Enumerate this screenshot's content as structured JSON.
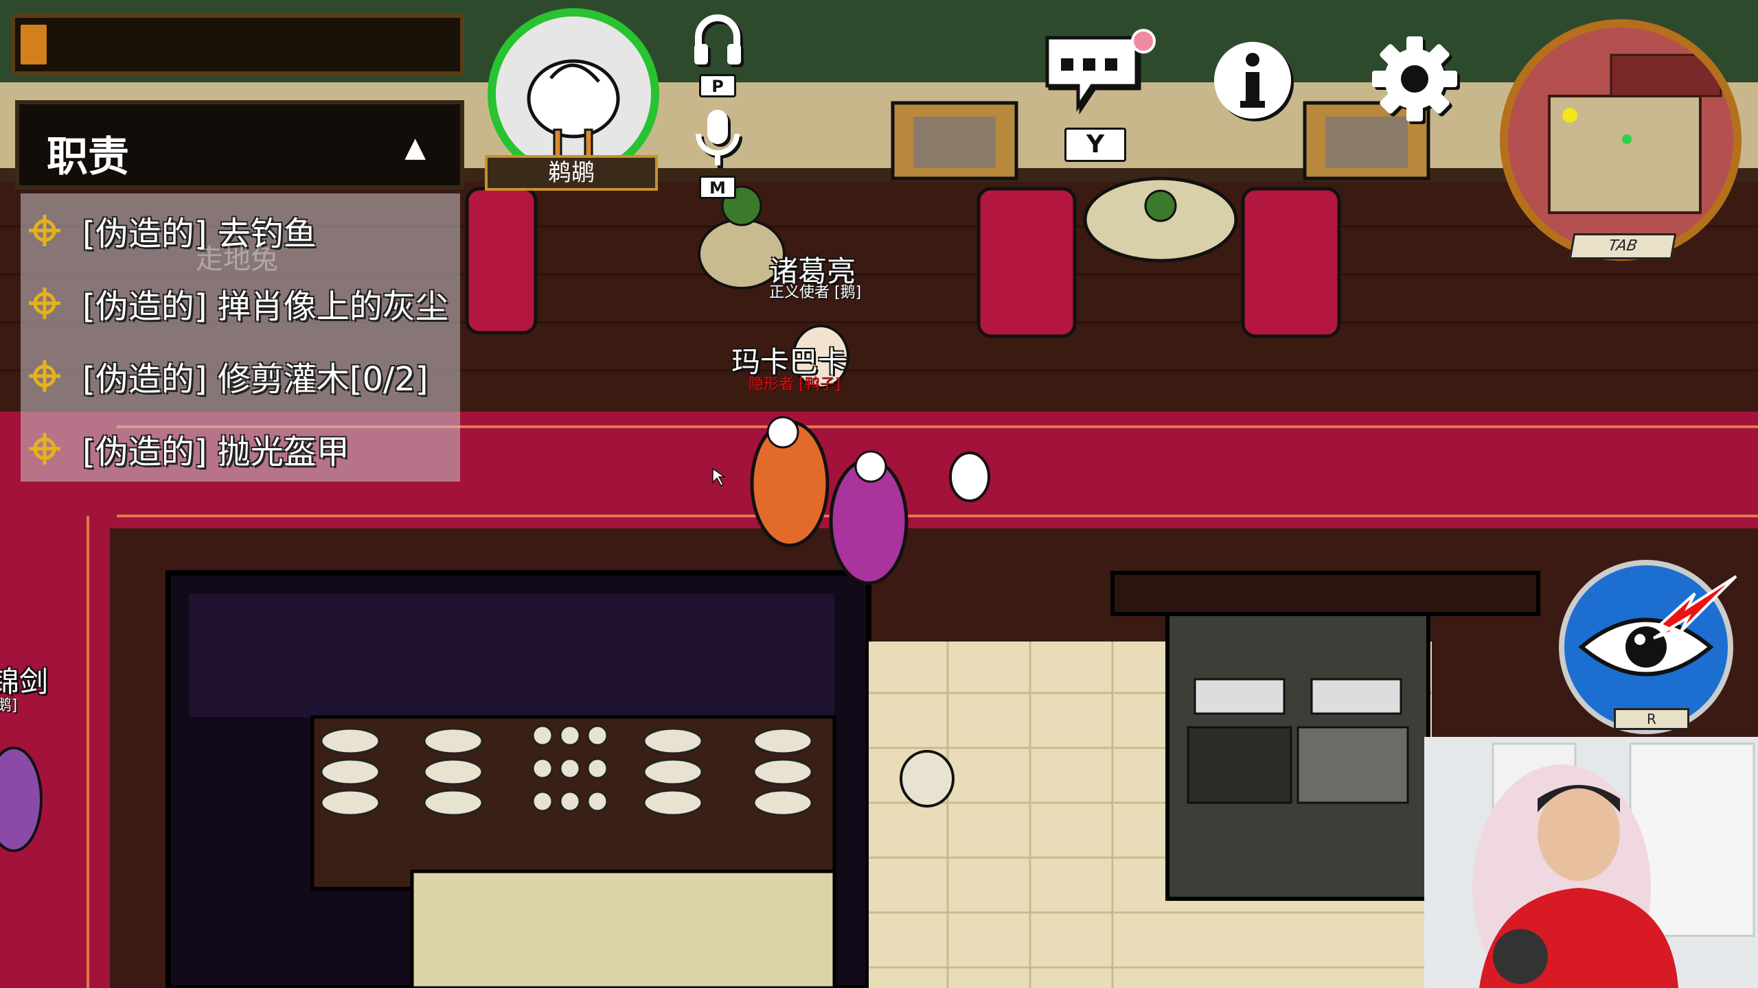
{
  "hud": {
    "progress_fraction": 0.06,
    "player_name": "鹈鹕",
    "headphone_key": "P",
    "mic_key": "M",
    "chat_key": "Y",
    "minimap_key": "TAB",
    "ability_key": "R"
  },
  "tasks": {
    "title": "职责",
    "collapse_glyph": "▲",
    "items": [
      {
        "label": "[伪造的] 去钓鱼"
      },
      {
        "label": "[伪造的] 掸肖像上的灰尘"
      },
      {
        "label": "[伪造的] 修剪灌木[0/2]"
      },
      {
        "label": "[伪造的] 抛光盔甲"
      }
    ]
  },
  "players": [
    {
      "name": "诸葛亮",
      "role": "正义使者 [鹅]"
    },
    {
      "name": "玛卡巴卡",
      "role": "隐形者 [鸭子]"
    },
    {
      "name": "锦剑",
      "role": "[鹅]"
    }
  ],
  "ghost_label": "走地兔",
  "colors": {
    "avatar_ring": "#27c331",
    "progress_fill": "#d1801a",
    "carpet": "#a3123a",
    "eye_button": "#1c6fd0",
    "minimap_border": "#b5701c"
  },
  "icons": [
    "headphones-icon",
    "microphone-icon",
    "chat-icon",
    "info-icon",
    "settings-gear-icon",
    "task-target-icon",
    "eye-ability-icon"
  ]
}
